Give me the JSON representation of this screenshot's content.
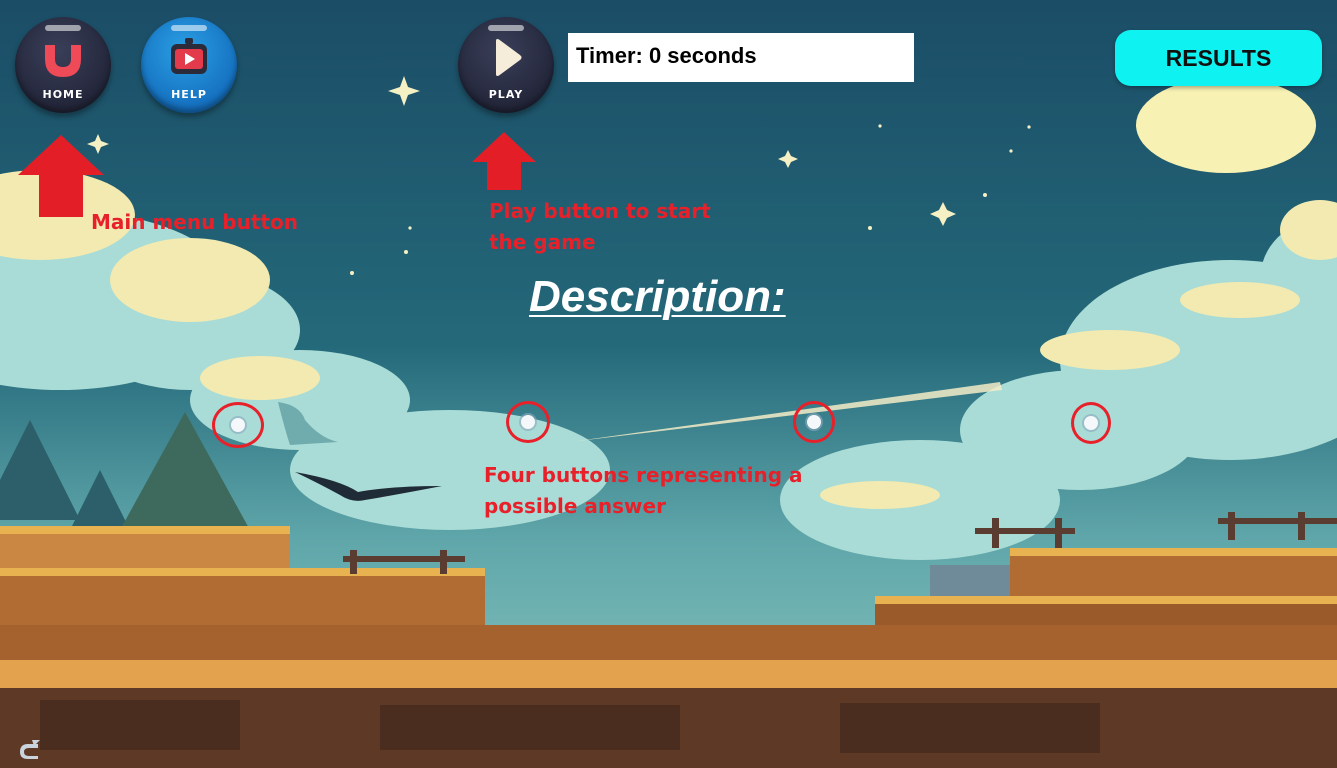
{
  "toolbar": {
    "home_label": "HOME",
    "help_label": "HELP",
    "play_label": "PLAY",
    "timer_text": "Timer: 0 seconds",
    "results_label": "RESULTS"
  },
  "annotations": {
    "home": "Main menu button",
    "play_line1": "Play button to start",
    "play_line2": "the game",
    "answers_line1": "Four buttons representing a",
    "answers_line2": "possible answer"
  },
  "main": {
    "description_title": "Description:"
  },
  "icons": {
    "home": "magnet-u-icon",
    "help": "tv-icon",
    "play": "play-triangle-icon",
    "annotation_arrow": "up-arrow-icon",
    "corner": "cursor-icon"
  },
  "colors": {
    "results_button": "#0ff2f2",
    "annotation_red": "#e8202a",
    "home_button": "#23263a",
    "help_button": "#1570bf",
    "timer_background": "#ffffff"
  }
}
